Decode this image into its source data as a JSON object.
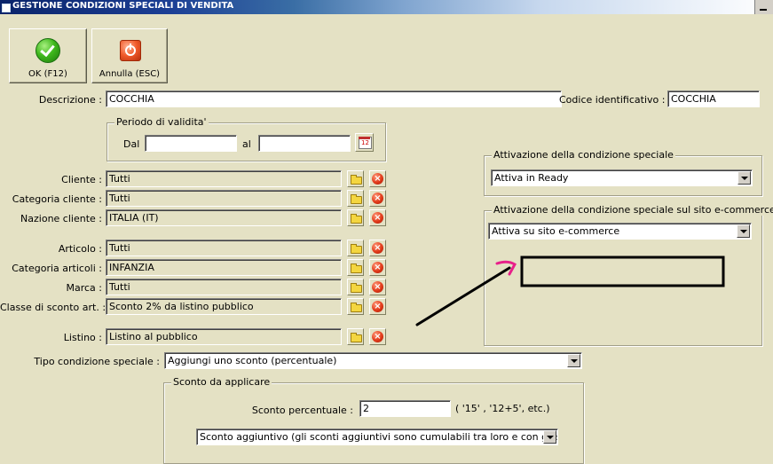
{
  "window": {
    "title": "GESTIONE CONDIZIONI SPECIALI DI VENDITA"
  },
  "toolbar": {
    "ok_label": "OK (F12)",
    "cancel_label": "Annulla (ESC)"
  },
  "header": {
    "descrizione_label": "Descrizione :",
    "descrizione_value": "COCCHIA",
    "codice_label": "Codice identificativo :",
    "codice_value": "COCCHIA"
  },
  "periodo": {
    "legend": "Periodo di validita'",
    "dal_label": "Dal",
    "dal_value": "",
    "al_label": "al",
    "al_value": "",
    "calendar_day": "12"
  },
  "filters": [
    {
      "label": "Cliente :",
      "value": "Tutti"
    },
    {
      "label": "Categoria cliente :",
      "value": "Tutti"
    },
    {
      "label": "Nazione cliente :",
      "value": "ITALIA (IT)"
    },
    {
      "label": "Articolo :",
      "value": "Tutti"
    },
    {
      "label": "Categoria articoli :",
      "value": "INFANZIA"
    },
    {
      "label": "Marca :",
      "value": "Tutti"
    },
    {
      "label": "Classe di sconto art. :",
      "value": "Sconto 2% da listino pubblico"
    },
    {
      "label": "Listino :",
      "value": "Listino al pubblico"
    }
  ],
  "delete_glyph": "×",
  "attivazione": {
    "legend": "Attivazione della condizione speciale",
    "selected": "Attiva in Ready"
  },
  "ecommerce": {
    "legend": "Attivazione della condizione speciale sul sito e-commerce",
    "selected": "Attiva su sito e-commerce"
  },
  "tipo": {
    "label": "Tipo condizione speciale :",
    "selected": "Aggiungi uno sconto (percentuale)"
  },
  "sconto": {
    "legend": "Sconto da applicare",
    "percent_label": "Sconto percentuale :",
    "percent_value": "2",
    "hint": "( '15' ,  '12+5', etc.)",
    "mode_selected": "Sconto aggiuntivo (gli sconti aggiuntivi sono cumulabili tra loro e con gli sconti prim"
  },
  "colors": {
    "background": "#e4e1c4",
    "annotation_arrow": "#000000",
    "annotation_pink": "#e8208a",
    "annotation_box": "#000000"
  }
}
